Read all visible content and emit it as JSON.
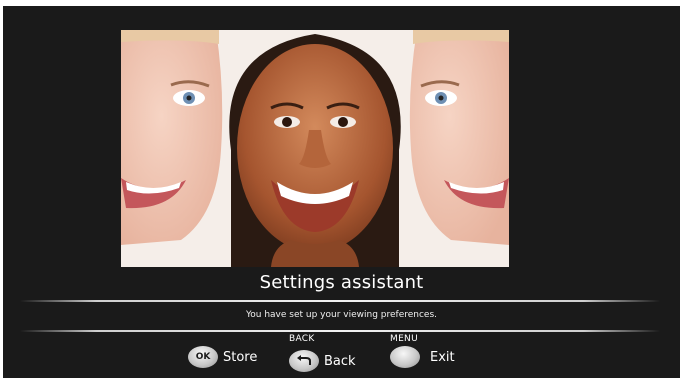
{
  "screen": {
    "title": "Settings assistant",
    "message": "You have set up your viewing preferences."
  },
  "buttons": {
    "store": {
      "key": "OK",
      "label": "Store"
    },
    "back": {
      "caption": "BACK",
      "label": "Back"
    },
    "exit": {
      "caption": "MENU",
      "label": "Exit"
    }
  },
  "icons": {
    "back": "back-arrow-icon",
    "menu": "menu-key-icon"
  },
  "colors": {
    "background": "#1a1a1a",
    "text": "#ffffff",
    "key": "#c9c9c9"
  }
}
